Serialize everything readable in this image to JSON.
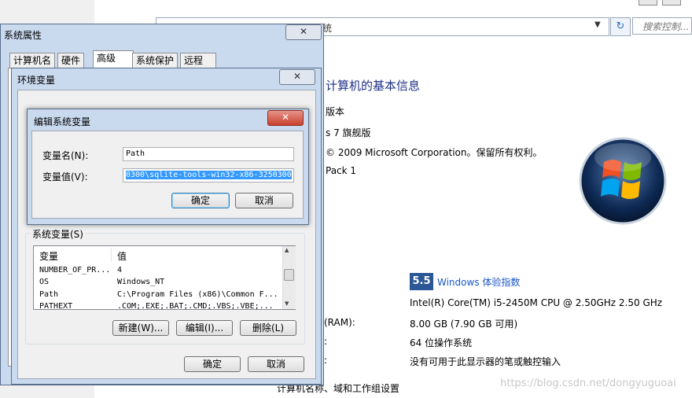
{
  "background_window": {
    "address_text": "统",
    "search_placeholder": "搜索控制...",
    "heading": "计算机的基本信息",
    "edition_label": "版本",
    "edition": "s 7 旗舰版",
    "copyright": "© 2009 Microsoft Corporation。保留所有权利。",
    "service_pack": "Pack 1",
    "experience_score": "5.5",
    "experience_link": "Windows 体验指数",
    "processor": "Intel(R) Core(TM) i5-2450M CPU @ 2.50GHz   2.50 GHz",
    "ram_label": "(RAM):",
    "ram": "8.00 GB (7.90 GB 可用)",
    "os_type_label": ":",
    "os_type": "64 位操作系统",
    "pen_label": ":",
    "pen": "没有可用于此显示器的笔或触控输入",
    "bottom_section": "计算机名称、域和工作组设置",
    "watermark": "https://blog.csdn.net/dongyuguoai",
    "logo_icon": "windows-logo-icon",
    "refresh_icon": "refresh-icon"
  },
  "system_properties": {
    "title": "系统属性",
    "close": "✕",
    "tabs": [
      "计算机名",
      "硬件",
      "高级",
      "系统保护",
      "远程"
    ],
    "active_tab": "高级"
  },
  "env_vars": {
    "title": "环境变量",
    "close": "✕",
    "system_vars_label": "系统变量(S)",
    "columns": [
      "变量",
      "值"
    ],
    "rows": [
      {
        "name": "NUMBER_OF_PR...",
        "value": "4"
      },
      {
        "name": "OS",
        "value": "Windows_NT"
      },
      {
        "name": "Path",
        "value": "C:\\Program Files (x86)\\Common F..."
      },
      {
        "name": "PATHEXT",
        "value": ".COM;.EXE;.BAT;.CMD;.VBS;.VBE;..."
      }
    ],
    "new_button": "新建(W)...",
    "edit_button": "编辑(I)...",
    "delete_button": "删除(L)",
    "ok_button": "确定",
    "cancel_button": "取消"
  },
  "edit_var": {
    "title": "编辑系统变量",
    "close": "✕",
    "name_label": "变量名(N):",
    "name_value": "Path",
    "value_label": "变量值(V):",
    "value_value": "0300\\sqlite-tools-win32-x86-3250300",
    "ok_button": "确定",
    "cancel_button": "取消"
  },
  "colors": {
    "accent": "#3399ff",
    "title_blue": "#1e3287",
    "link_blue": "#1a56c9",
    "close_red": "#c9412e"
  }
}
